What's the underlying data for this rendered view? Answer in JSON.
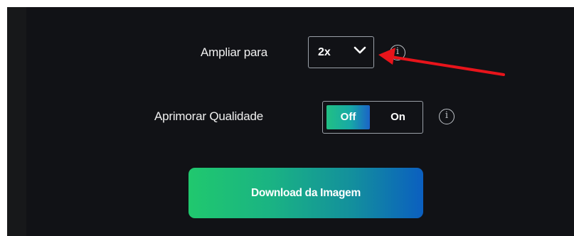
{
  "scale": {
    "label": "Ampliar para",
    "selected": "2x",
    "info_icon": "info-icon"
  },
  "quality": {
    "label": "Aprimorar Qualidade",
    "off_label": "Off",
    "on_label": "On",
    "selected": "Off",
    "info_icon": "info-icon"
  },
  "download": {
    "label": "Download da Imagem"
  },
  "colors": {
    "panel_bg": "#111216",
    "left_bar_bg": "#17181a",
    "accent_green": "#20c86e",
    "accent_blue": "#0b5fc0",
    "annotation_arrow": "#e8141b"
  },
  "annotation": {
    "icon": "red-arrow",
    "points_to": "scale-select"
  }
}
